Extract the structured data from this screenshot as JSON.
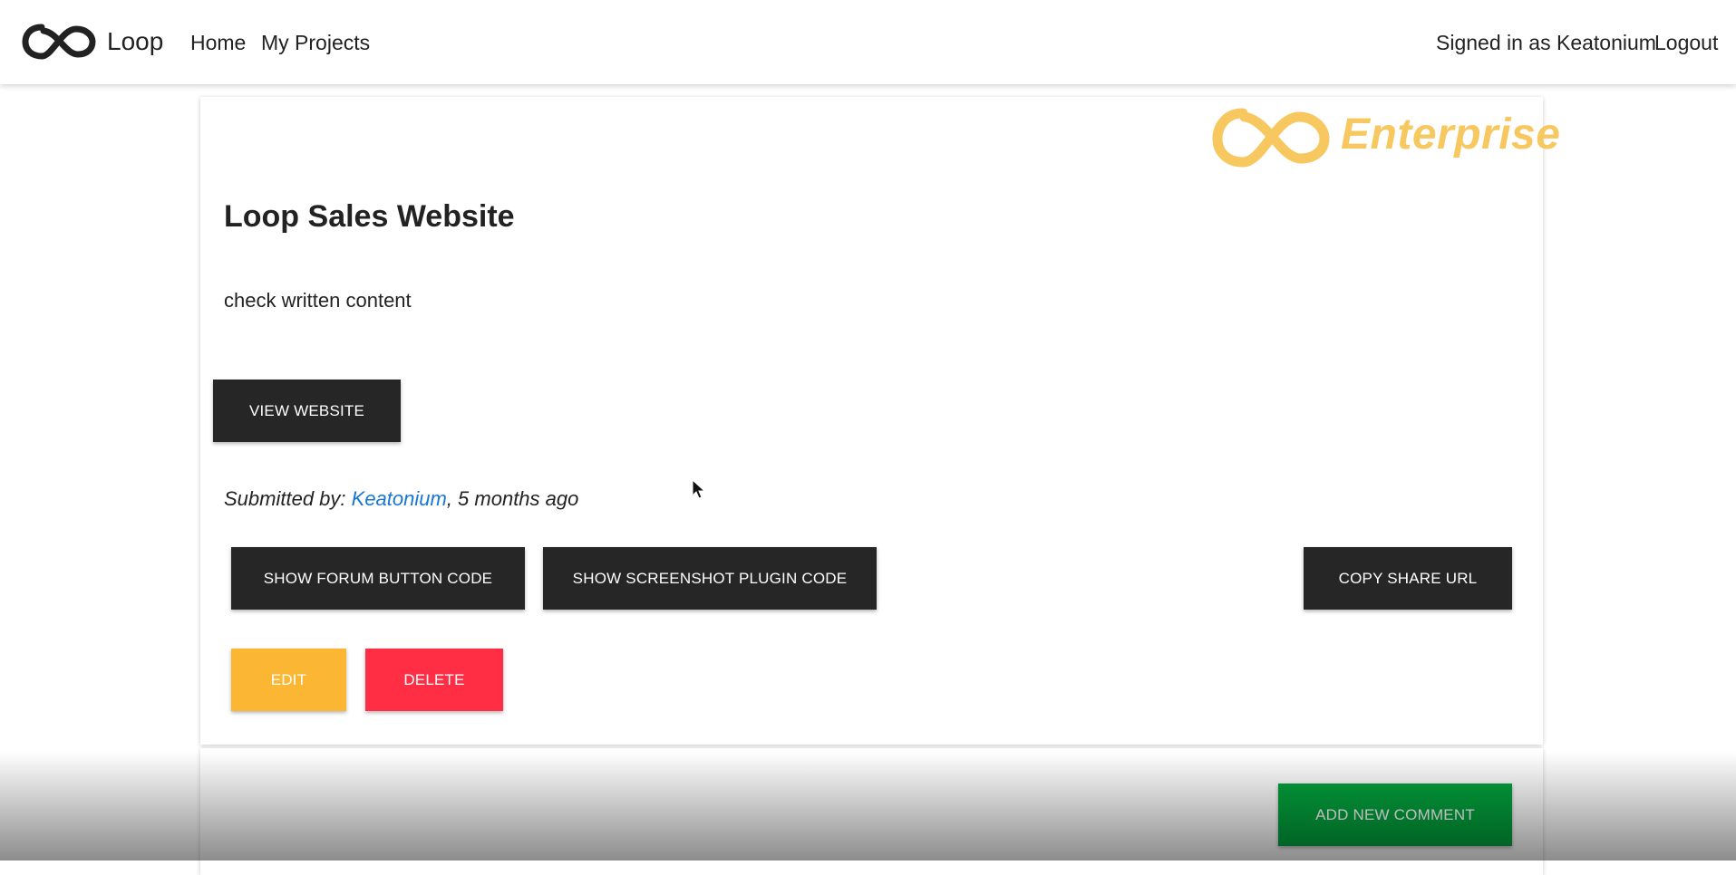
{
  "header": {
    "logo_icon": "infinity-loop-logo",
    "brand": "Loop",
    "nav": [
      {
        "label": "Home"
      },
      {
        "label": "My Projects"
      }
    ],
    "signed_in": "Signed in as Keatonium",
    "logout": "Logout"
  },
  "project": {
    "badge_icon": "infinity-loop-logo",
    "badge_text": "Enterprise",
    "title": "Loop Sales Website",
    "description": "check written content",
    "view_website": "VIEW WEBSITE",
    "submitted_label": "Submitted by: ",
    "submitted_user": "Keatonium",
    "submitted_time": ", 5 months ago",
    "buttons": {
      "forum_code": "SHOW FORUM BUTTON CODE",
      "screenshot_code": "SHOW SCREENSHOT PLUGIN CODE",
      "copy_share": "COPY SHARE URL",
      "edit": "EDIT",
      "delete": "DELETE"
    }
  },
  "comments": {
    "add_new": "ADD NEW COMMENT"
  },
  "colors": {
    "dark_button": "#262626",
    "edit_button": "#fbb733",
    "delete_button": "#ff2e45",
    "add_comment_button": "#02a33d",
    "enterprise_accent": "#f7c85f",
    "link": "#1976d2"
  }
}
